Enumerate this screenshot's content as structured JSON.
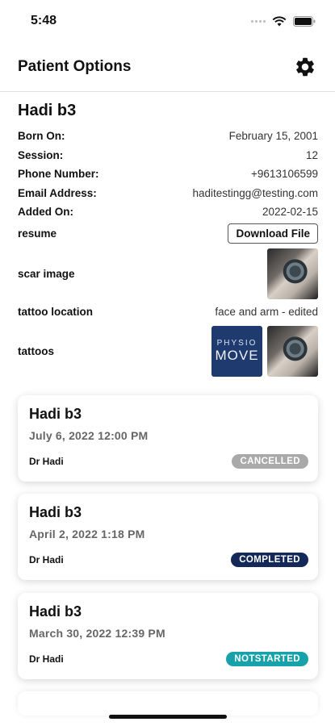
{
  "status_bar": {
    "time": "5:48"
  },
  "header": {
    "title": "Patient Options",
    "settings_icon": "gear-icon"
  },
  "patient": {
    "name": "Hadi b3",
    "fields": {
      "born_on": {
        "label": "Born On:",
        "value": "February 15, 2001"
      },
      "session": {
        "label": "Session:",
        "value": "12"
      },
      "phone": {
        "label": "Phone Number:",
        "value": "+9613106599"
      },
      "email": {
        "label": "Email Address:",
        "value": "haditestingg@testing.com"
      },
      "added_on": {
        "label": "Added On:",
        "value": "2022-02-15"
      }
    },
    "resume": {
      "label": "resume",
      "button": "Download File"
    },
    "scar_image": {
      "label": "scar image"
    },
    "tattoo_location": {
      "label": "tattoo location",
      "value": "face and arm - edited"
    },
    "tattoos": {
      "label": "tattoos",
      "logo_top": "PHYSIO",
      "logo_main": "MOVE"
    }
  },
  "sessions": [
    {
      "patient": "Hadi b3",
      "date": "July 6, 2022 12:00 PM",
      "doctor": "Dr Hadi",
      "status": "CANCELLED",
      "status_color": "#a9a9a9"
    },
    {
      "patient": "Hadi b3",
      "date": "April 2, 2022 1:18 PM",
      "doctor": "Dr Hadi",
      "status": "COMPLETED",
      "status_color": "#14295a"
    },
    {
      "patient": "Hadi b3",
      "date": "March 30, 2022 12:39 PM",
      "doctor": "Dr Hadi",
      "status": "NOTSTARTED",
      "status_color": "#17a2ab"
    }
  ]
}
